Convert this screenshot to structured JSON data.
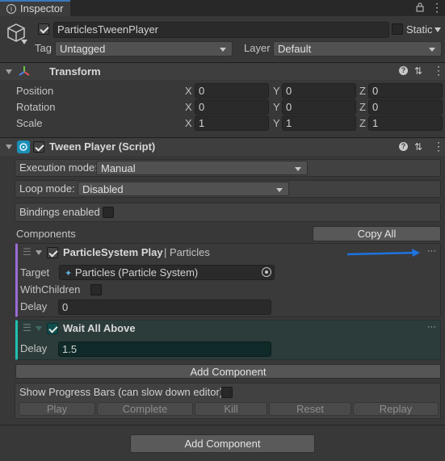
{
  "tab": {
    "title": "Inspector"
  },
  "object": {
    "name": "ParticlesTweenPlayer",
    "static_label": "Static",
    "tag_label": "Tag",
    "tag_value": "Untagged",
    "layer_label": "Layer",
    "layer_value": "Default"
  },
  "transform": {
    "title": "Transform",
    "rows": [
      {
        "label": "Position",
        "x": "0",
        "y": "0",
        "z": "0"
      },
      {
        "label": "Rotation",
        "x": "0",
        "y": "0",
        "z": "0"
      },
      {
        "label": "Scale",
        "x": "1",
        "y": "1",
        "z": "1"
      }
    ],
    "axes": {
      "x": "X",
      "y": "Y",
      "z": "Z"
    }
  },
  "tween": {
    "title": "Tween Player (Script)",
    "execution_label": "Execution mode:",
    "execution_value": "Manual",
    "loop_label": "Loop mode:",
    "loop_value": "Disabled",
    "bindings_label": "Bindings enabled",
    "components_label": "Components",
    "copy_all_label": "Copy All",
    "comp1": {
      "title": "ParticleSystem Play",
      "subtitle": "| Particles",
      "target_label": "Target",
      "target_value": "Particles (Particle System)",
      "children_label": "WithChildren",
      "delay_label": "Delay",
      "delay_value": "0"
    },
    "comp2": {
      "title": "Wait All Above",
      "delay_label": "Delay",
      "delay_value": "1.5"
    },
    "add_component_label": "Add Component",
    "progress_label": "Show Progress Bars (can slow down editor)",
    "controls": [
      "Play",
      "Complete",
      "Kill",
      "Reset",
      "Replay"
    ]
  },
  "footer": {
    "add_component_label": "Add Component"
  },
  "colors": {
    "accent_purple": "#9b6ad8",
    "accent_teal": "#20c0b0",
    "arrow_blue": "#1e73e0"
  }
}
